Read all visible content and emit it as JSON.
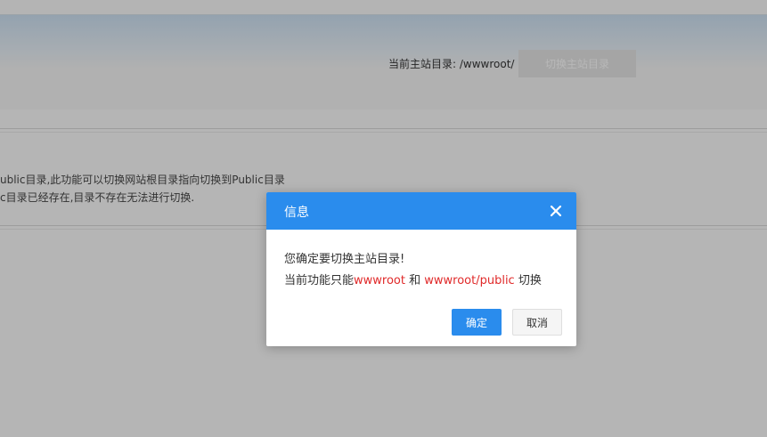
{
  "background": {
    "site_dir_label": "当前主站目录: /wwwroot/",
    "switch_button_label": "切换主站目录",
    "notes": [
      "ublic目录,此功能可以切换网站根目录指向切换到Public目录",
      "c目录已经存在,目录不存在无法进行切换."
    ]
  },
  "dialog": {
    "title": "信息",
    "message_line1": "您确定要切换主站目录!",
    "message_line2_prefix": "当前功能只能",
    "message_line2_highlight1": "wwwroot",
    "message_line2_middle": " 和 ",
    "message_line2_highlight2": "wwwroot/public",
    "message_line2_suffix": " 切换",
    "confirm_label": "确定",
    "cancel_label": "取消",
    "close_icon": "close-icon"
  },
  "colors": {
    "accent": "#2a8ced",
    "highlight": "#e02a2a"
  }
}
